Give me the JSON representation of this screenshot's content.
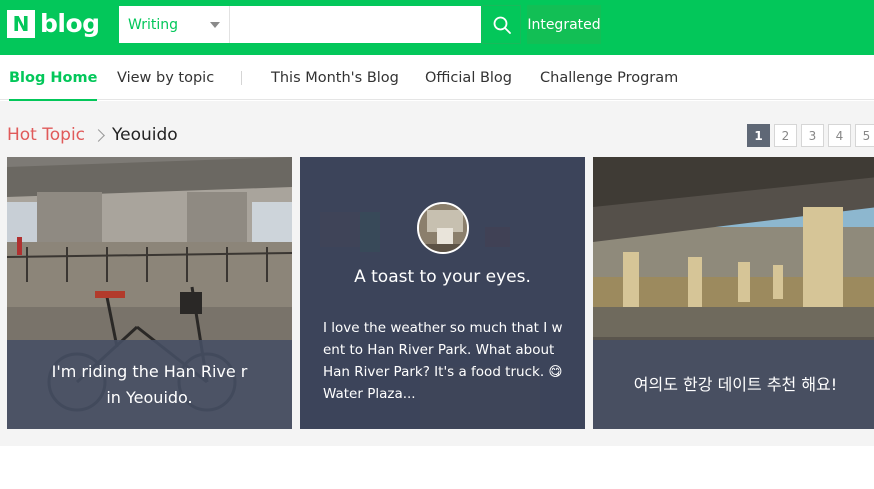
{
  "header": {
    "logo_letter": "N",
    "logo_text": "blog",
    "search_scope": "Writing",
    "search_value": "",
    "search_placeholder": "",
    "integrated_label": "Integrated"
  },
  "nav": {
    "items": [
      {
        "label": "Blog Home",
        "active": true
      },
      {
        "label": "View by topic",
        "active": false
      },
      {
        "label": "This Month's Blog",
        "active": false
      },
      {
        "label": "Official Blog",
        "active": false
      },
      {
        "label": "Challenge Program",
        "active": false
      }
    ]
  },
  "topic": {
    "section_label": "Hot Topic",
    "name": "Yeouido"
  },
  "pagination": {
    "pages": [
      "1",
      "2",
      "3",
      "4",
      "5"
    ],
    "current": "1"
  },
  "cards": [
    {
      "caption": "I'm riding the Han Rive r in Yeouido."
    },
    {
      "title": "A toast to your eyes.",
      "snippet": "I love the weather so much that I w ent to Han River Park. What about Han River Park? It's a food truck. 😋 Water Plaza..."
    },
    {
      "caption": "여의도 한강 데이트 추천 해요!"
    }
  ],
  "colors": {
    "brand": "#03c75a",
    "hot_topic": "#e05a5a",
    "caption_overlay": "#464e64"
  }
}
